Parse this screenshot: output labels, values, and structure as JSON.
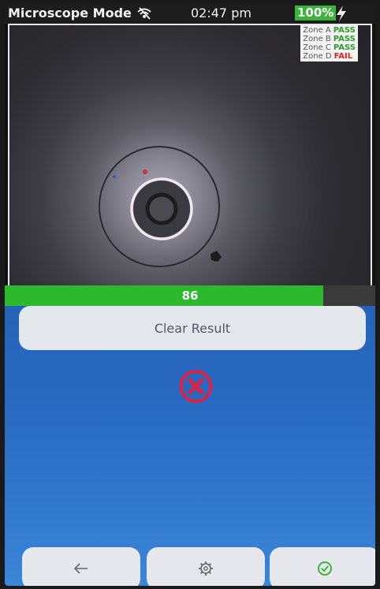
{
  "status_bar": {
    "title": "Microscope Mode",
    "time": "02:47 pm",
    "battery": "100%",
    "icons": [
      "wifi-icon",
      "bolt-icon"
    ]
  },
  "microscope": {
    "zones": [
      {
        "label": "Zone A",
        "status": "PASS"
      },
      {
        "label": "Zone B",
        "status": "PASS"
      },
      {
        "label": "Zone C",
        "status": "PASS"
      },
      {
        "label": "Zone D",
        "status": "FAIL"
      }
    ]
  },
  "score": {
    "value": "86",
    "fraction": 0.86,
    "color": "#2eb82e"
  },
  "panel": {
    "clear_button_label": "Clear Result",
    "result_icon": "fail-x-icon",
    "background_color": "#2a6dc4"
  },
  "nav": {
    "back_icon": "arrow-left-icon",
    "settings_icon": "gear-icon",
    "confirm_icon": "check-circle-icon"
  },
  "colors": {
    "pass": "#2e9a2e",
    "fail": "#dd2244",
    "ring": "#f0e8f0"
  }
}
